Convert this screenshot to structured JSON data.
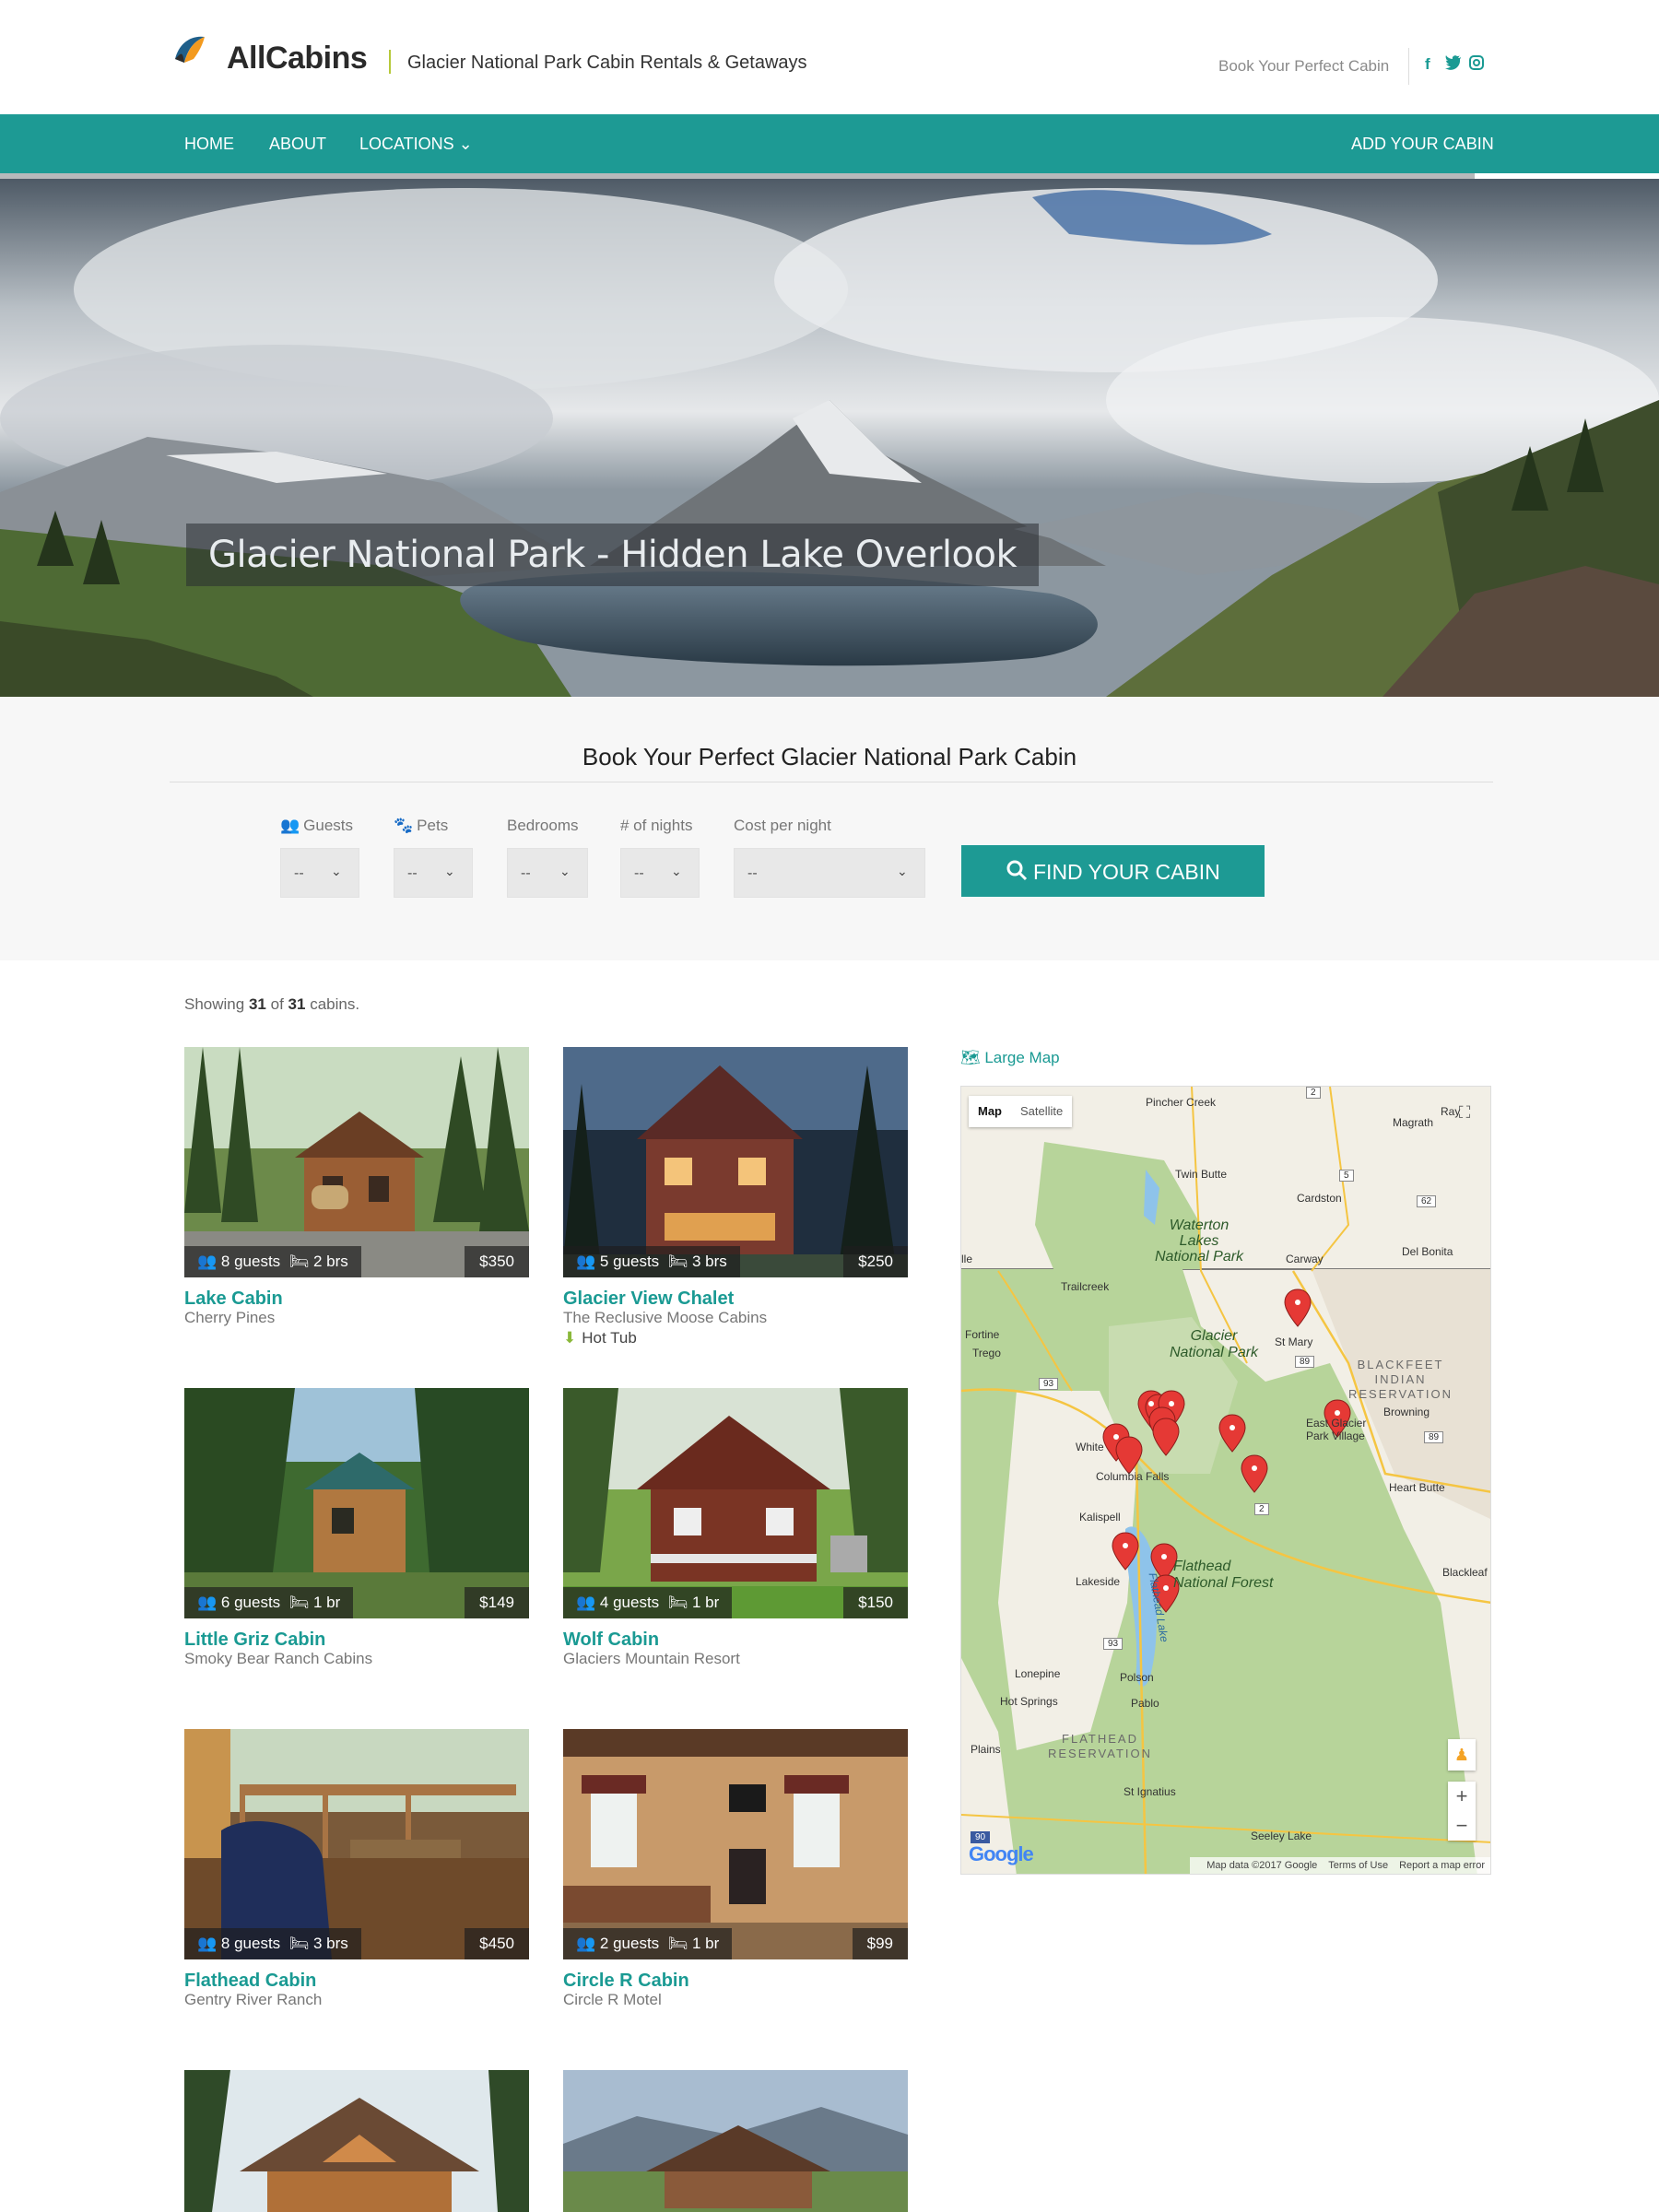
{
  "header": {
    "logo_text": "AllCabins",
    "tagline": "Glacier National Park Cabin Rentals & Getaways",
    "book_link": "Book Your Perfect Cabin",
    "social": [
      "facebook-icon",
      "twitter-icon",
      "instagram-icon"
    ],
    "social_glyphs": {
      "facebook": "f",
      "twitter": "🐦",
      "instagram": "◎"
    }
  },
  "nav": {
    "home": "HOME",
    "about": "ABOUT",
    "locations": "LOCATIONS ⌄",
    "add": "ADD YOUR CABIN"
  },
  "hero": {
    "caption": "Glacier National Park - Hidden Lake Overlook"
  },
  "search": {
    "title": "Book Your Perfect Glacier National Park Cabin",
    "fields": [
      {
        "label": "Guests",
        "value": "--",
        "icon": "group-icon"
      },
      {
        "label": "Pets",
        "value": "--",
        "icon": "paw-icon"
      },
      {
        "label": "Bedrooms",
        "value": "--"
      },
      {
        "label": "# of nights",
        "value": "--"
      },
      {
        "label": "Cost per night",
        "value": "--"
      }
    ],
    "button": "FIND YOUR CABIN"
  },
  "results": {
    "showing_prefix": "Showing",
    "shown": "31",
    "of": "of",
    "total": "31",
    "suffix": "cabins.",
    "cards": [
      {
        "guests": "8 guests",
        "beds": "2 brs",
        "price": "$350",
        "name": "Lake Cabin",
        "org": "Cherry Pines"
      },
      {
        "guests": "5 guests",
        "beds": "3 brs",
        "price": "$250",
        "name": "Glacier View Chalet",
        "org": "The Reclusive Moose Cabins",
        "amenity": "Hot Tub"
      },
      {
        "guests": "6 guests",
        "beds": "1 br",
        "price": "$149",
        "name": "Little Griz Cabin",
        "org": "Smoky Bear Ranch Cabins"
      },
      {
        "guests": "4 guests",
        "beds": "1 br",
        "price": "$150",
        "name": "Wolf Cabin",
        "org": "Glaciers Mountain Resort"
      },
      {
        "guests": "8 guests",
        "beds": "3 brs",
        "price": "$450",
        "name": "Flathead Cabin",
        "org": "Gentry River Ranch"
      },
      {
        "guests": "2 guests",
        "beds": "1 br",
        "price": "$99",
        "name": "Circle R Cabin",
        "org": "Circle R Motel"
      }
    ]
  },
  "map": {
    "large_map": "Large Map",
    "type_map": "Map",
    "type_satellite": "Satellite",
    "google": "Google",
    "attribution": "Map data ©2017 Google",
    "terms": "Terms of Use",
    "report": "Report a map error",
    "labels": {
      "pincher": "Pincher Creek",
      "magrath": "Magrath",
      "raymond": "Ray",
      "twinbutte": "Twin Butte",
      "cardston": "Cardston",
      "waterton": "Waterton\nLakes\nNational Park",
      "carway": "Carway",
      "delbonita": "Del Bonita",
      "trailcreek": "Trailcreek",
      "fortine": "Fortine",
      "trego": "Trego",
      "glacier": "Glacier\nNational Park",
      "stmary": "St Mary",
      "blackfeet": "BLACKFEET\nINDIAN\nRESERVATION",
      "browning": "Browning",
      "eastglacier": "East Glacier\nPark Village",
      "white": "White",
      "colfalls": "Columbia Falls",
      "heartbutte": "Heart Butte",
      "kalispell": "Kalispell",
      "lakeside": "Lakeside",
      "flathead": "Flathead\nNational Forest",
      "flatheadlake": "Flathead Lake",
      "blackleaf": "Blackleaf",
      "lonepine": "Lonepine",
      "polson": "Polson",
      "hotsprings": "Hot Springs",
      "pablo": "Pablo",
      "flatres": "FLATHEAD\nRESERVATION",
      "plains": "Plains",
      "stignatius": "St Ignatius",
      "seeleylake": "Seeley Lake",
      "ile": "lle"
    },
    "highway_shields": [
      "2",
      "5",
      "62",
      "89",
      "93",
      "89",
      "2",
      "93",
      "90"
    ]
  },
  "colors": {
    "teal": "#1d9a94",
    "lime": "#8ab83a",
    "pin": "#e53935"
  }
}
